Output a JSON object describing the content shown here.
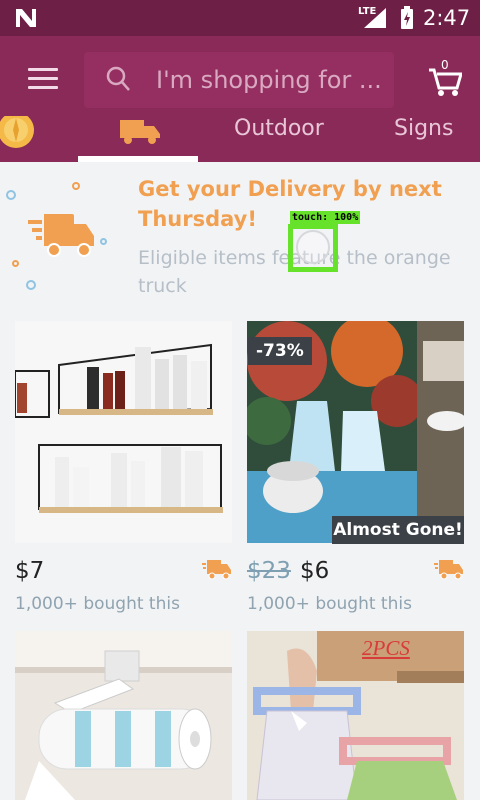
{
  "status_bar": {
    "network": "LTE",
    "time": "2:47"
  },
  "header": {
    "search_placeholder": "I'm shopping for ...",
    "cart_count": "0",
    "tabs": [
      {
        "label": "",
        "icon": "sun-icon"
      },
      {
        "label": "",
        "icon": "delivery-truck-icon"
      },
      {
        "label": "Outdoor"
      },
      {
        "label": "Signs"
      }
    ]
  },
  "banner": {
    "title": "Get your Delivery by next Thursday!",
    "subtitle": "Eligible items feature the orange truck"
  },
  "touch_overlay": {
    "label": "touch: 100%"
  },
  "products": [
    {
      "price": "$7",
      "old_price": "",
      "bought": "1,000+ bought this",
      "badge": ""
    },
    {
      "price": "$6",
      "old_price": "$23",
      "bought": "1,000+ bought this",
      "badge": "-73%",
      "tag": "Almost Gone!"
    },
    {
      "overlay_text": ""
    },
    {
      "overlay_text": "2PCS"
    }
  ],
  "colors": {
    "status_bar": "#6e1f45",
    "header": "#8a2a58",
    "accent_orange": "#f0a050",
    "touch_green": "#66e22a"
  }
}
